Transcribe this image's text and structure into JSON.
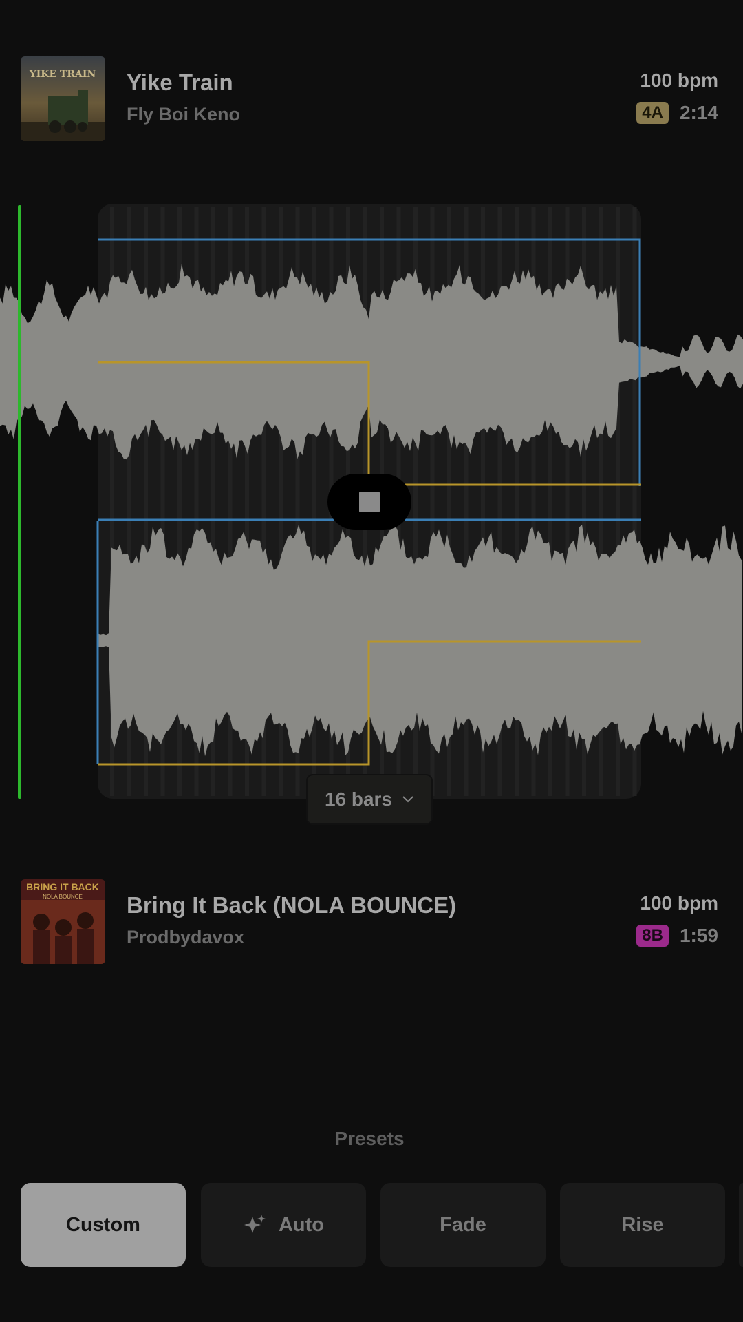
{
  "tracks": [
    {
      "title": "Yike Train",
      "artist": "Fly Boi Keno",
      "bpm": "100 bpm",
      "key": "4A",
      "duration": "2:14",
      "cover_text": "YIKE TRAIN",
      "key_color": "#8a7b4f"
    },
    {
      "title": "Bring It Back (NOLA BOUNCE)",
      "artist": "Prodbydavox",
      "bpm": "100 bpm",
      "key": "8B",
      "duration": "1:59",
      "cover_text": "BRING IT BACK",
      "cover_subtext": "NOLA BOUNCE",
      "key_color": "#9b2a8b"
    }
  ],
  "transition": {
    "length_label": "16 bars",
    "playing": true
  },
  "presets": {
    "header": "Presets",
    "items": [
      {
        "label": "Custom",
        "active": true
      },
      {
        "label": "Auto",
        "icon": "sparkle-icon",
        "active": false
      },
      {
        "label": "Fade",
        "active": false
      },
      {
        "label": "Rise",
        "active": false
      }
    ]
  },
  "colors": {
    "playhead": "#2db82d",
    "automation_blue": "#3b7fb5",
    "automation_gold": "#b8952a",
    "waveform": "#8a8a86",
    "background": "#0e0e0e"
  }
}
